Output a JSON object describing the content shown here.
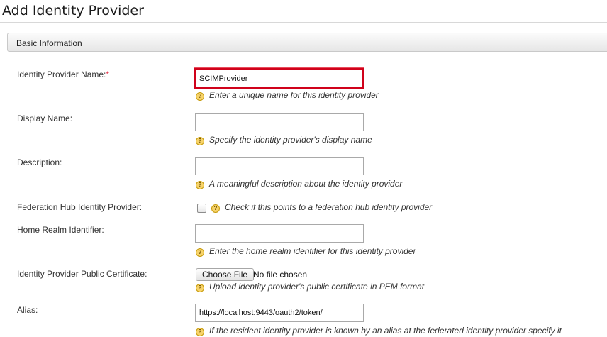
{
  "page": {
    "title": "Add Identity Provider"
  },
  "section": {
    "title": "Basic Information"
  },
  "fields": {
    "idp_name": {
      "label": "Identity Provider Name:",
      "required_mark": "*",
      "value": "SCIMProvider",
      "help": "Enter a unique name for this identity provider"
    },
    "display_name": {
      "label": "Display Name:",
      "value": "",
      "help": "Specify the identity provider's display name"
    },
    "description": {
      "label": "Description:",
      "value": "",
      "help": "A meaningful description about the identity provider"
    },
    "federation_hub": {
      "label": "Federation Hub Identity Provider:",
      "checked": false,
      "help": "Check if this points to a federation hub identity provider"
    },
    "home_realm": {
      "label": "Home Realm Identifier:",
      "value": "",
      "help": "Enter the home realm identifier for this identity provider"
    },
    "public_certificate": {
      "label": "Identity Provider Public Certificate:",
      "button_label": "Choose File",
      "file_status": "No file chosen",
      "help": "Upload identity provider's public certificate in PEM format"
    },
    "alias": {
      "label": "Alias:",
      "value": "https://localhost:9443/oauth2/token/",
      "help": "If the resident identity provider is known by an alias at the federated identity provider specify it"
    }
  },
  "icons": {
    "help": "help-icon",
    "help_glyph": "?"
  },
  "colors": {
    "highlight_border": "#d0021b",
    "required_mark": "#e8334a",
    "help_icon": "#f7d36a"
  }
}
